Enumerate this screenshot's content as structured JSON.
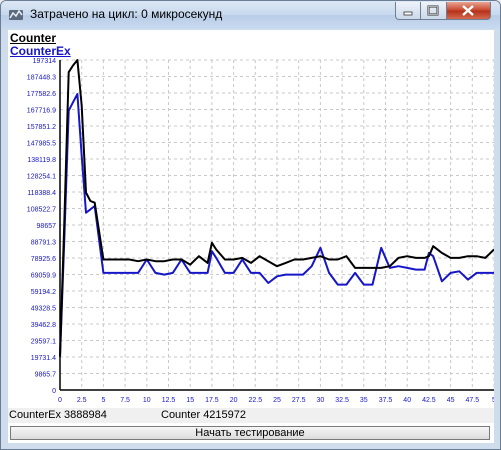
{
  "window": {
    "title": "Затрачено на цикл: 0 микросекунд",
    "icon": "chart-app-icon",
    "controls": [
      "minimize-icon",
      "maximize-icon",
      "close-icon"
    ]
  },
  "legend": {
    "counter_label": "Counter",
    "counterex_label": "CounterEx"
  },
  "status": {
    "counterex_text": "CounterEx 3888984",
    "counter_text": "Counter 4215972"
  },
  "start_button_label": "Начать тестирование",
  "colors": {
    "counter_series": "#000000",
    "counterex_series": "#1616c8",
    "axis_ticks": "#1616c8",
    "grid": "#c8c8c8"
  },
  "chart_data": {
    "type": "line",
    "grid": true,
    "xlim": [
      0,
      50
    ],
    "ylim": [
      0,
      197314
    ],
    "x_ticks": [
      "0",
      "2.5",
      "5",
      "7.5",
      "10",
      "12.5",
      "15",
      "17.5",
      "20",
      "22.5",
      "25",
      "27.5",
      "30",
      "32.5",
      "35",
      "37.5",
      "40",
      "42.5",
      "45",
      "47.5",
      "5"
    ],
    "y_ticks": [
      "0",
      "9865.7",
      "19731.4",
      "29597.1",
      "39462.8",
      "49328.5",
      "59194.2",
      "69059.9",
      "78925.6",
      "88791.3",
      "98657",
      "108522.7",
      "118388.4",
      "128254.1",
      "138119.8",
      "147985.5",
      "157851.2",
      "167716.9",
      "177582.6",
      "187448.3",
      "197314"
    ],
    "x": [
      0,
      0.5,
      1,
      1.5,
      2,
      2.5,
      3,
      3.5,
      4,
      5,
      6,
      7,
      8,
      9,
      10,
      11,
      12,
      13,
      14,
      15,
      16,
      17,
      17.5,
      18,
      19,
      20,
      21,
      22,
      23,
      24,
      25,
      26,
      27,
      28,
      29,
      30,
      31,
      32,
      33,
      34,
      35,
      36,
      37,
      38,
      39,
      40,
      41,
      42,
      42.5,
      43,
      44,
      45,
      46,
      47,
      48,
      49,
      50
    ],
    "series": [
      {
        "name": "Counter",
        "values": [
          20000,
          100000,
          190000,
          194000,
          197314,
          170000,
          118000,
          113000,
          112000,
          78000,
          78000,
          78000,
          78000,
          77000,
          78000,
          77000,
          77000,
          78000,
          78000,
          75000,
          80000,
          76000,
          88000,
          84000,
          78000,
          78000,
          79000,
          76000,
          80000,
          77000,
          74000,
          76000,
          78000,
          78000,
          79000,
          80000,
          78000,
          78000,
          80000,
          73000,
          73000,
          73000,
          73000,
          74000,
          79000,
          80000,
          79000,
          79000,
          80000,
          86000,
          82000,
          79000,
          79000,
          80000,
          80000,
          79000,
          84000
        ]
      },
      {
        "name": "CounterEx",
        "values": [
          20000,
          90000,
          167000,
          172000,
          177000,
          140000,
          106000,
          108000,
          110000,
          70000,
          70000,
          70000,
          70000,
          70000,
          78000,
          70000,
          69000,
          70000,
          78000,
          70000,
          70000,
          70000,
          83000,
          79000,
          70000,
          70000,
          78000,
          70000,
          70000,
          64000,
          68000,
          69000,
          69000,
          69000,
          74000,
          85000,
          70000,
          63000,
          63000,
          70000,
          63000,
          63000,
          85000,
          73000,
          74000,
          73000,
          72000,
          72000,
          82000,
          80000,
          65000,
          70000,
          71000,
          66000,
          70000,
          70000,
          70000
        ]
      }
    ]
  }
}
